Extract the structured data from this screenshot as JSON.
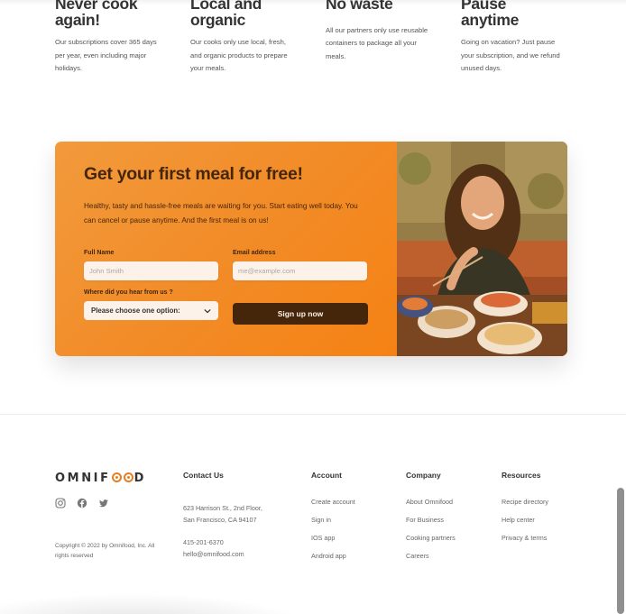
{
  "features": [
    {
      "title": "Never cook again!",
      "text": "Our subscriptions cover 365 days per year, even including major holidays."
    },
    {
      "title": "Local and organic",
      "text": "Our cooks only use local, fresh, and organic products to prepare your meals."
    },
    {
      "title": "No waste",
      "text": "All our partners only use reusable containers to package all your meals."
    },
    {
      "title": "Pause anytime",
      "text": "Going on vacation? Just pause your subscription, and we refund unused days."
    }
  ],
  "cta": {
    "title": "Get your first meal for free!",
    "text": "Healthy, tasty and hassle-free meals are waiting for you. Start eating well today. You can cancel or pause anytime. And the first meal is on us!",
    "form": {
      "full_name_label": "Full Name",
      "full_name_placeholder": "John Smith",
      "email_label": "Email address",
      "email_placeholder": "me@example.com",
      "source_label": "Where did you hear from us ?",
      "source_selected": "Please choose one option:",
      "submit_label": "Sign up now"
    }
  },
  "footer": {
    "logo": {
      "prefix": "OMNIF",
      "suffix": "D"
    },
    "socials": [
      "instagram-icon",
      "facebook-icon",
      "twitter-icon"
    ],
    "copyright": "Copyright © 2022 by Omnifood, Inc. All rights reserved",
    "contact": {
      "title": "Contact Us",
      "address_line1": "623 Harrison St., 2nd Floor,",
      "address_line2": "San Francisco, CA 94107",
      "phone": "415-201-6370",
      "email": "hello@omnifood.com"
    },
    "account": {
      "title": "Account",
      "links": [
        "Create account",
        "Sign in",
        "IOS app",
        "Android app"
      ]
    },
    "company": {
      "title": "Company",
      "links": [
        "About Omnifood",
        "For Business",
        "Cooking partners",
        "Careers"
      ]
    },
    "resources": {
      "title": "Resources",
      "links": [
        "Recipe directory",
        "Help center",
        "Privacy & terms"
      ]
    }
  },
  "colors": {
    "primary": "#e67e22",
    "dark_brown": "#45260a",
    "tint": "#fdf2e9"
  }
}
